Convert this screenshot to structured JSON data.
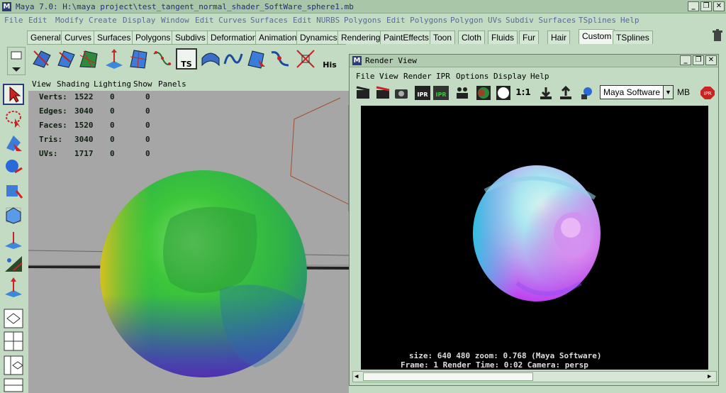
{
  "window": {
    "title": "Maya 7.0: H:\\maya project\\test_tangent_normal_shader_SoftWare_sphere1.mb",
    "minimize_glyph": "_",
    "restore_glyph": "❐",
    "close_glyph": "✕"
  },
  "menubar": [
    "File",
    "Edit",
    "Modify",
    "Create",
    "Display",
    "Window",
    "Edit Curves",
    "Surfaces",
    "Edit NURBS",
    "Polygons",
    "Edit Polygons",
    "Polygon UVs",
    "Subdiv Surfaces",
    "TSplines",
    "Help"
  ],
  "shelf_tabs": [
    "General",
    "Curves",
    "Surfaces",
    "Polygons",
    "Subdivs",
    "Deformation",
    "Animation",
    "Dynamics",
    "Rendering",
    "PaintEffects",
    "Toon",
    "Cloth",
    "Fluids",
    "Fur",
    "Hair",
    "Custom",
    "TSplines"
  ],
  "active_shelf_tab": "Custom",
  "shelf": {
    "ts_label": "TS",
    "his_label": "His"
  },
  "viewport": {
    "menu": [
      "View",
      "Shading",
      "Lighting",
      "Show",
      "Panels"
    ],
    "hud": [
      {
        "label": "Verts:",
        "v1": "1522",
        "v2": "0",
        "v3": "0"
      },
      {
        "label": "Edges:",
        "v1": "3040",
        "v2": "0",
        "v3": "0"
      },
      {
        "label": "Faces:",
        "v1": "1520",
        "v2": "0",
        "v3": "0"
      },
      {
        "label": "Tris:",
        "v1": "3040",
        "v2": "0",
        "v3": "0"
      },
      {
        "label": "UVs:",
        "v1": "1717",
        "v2": "0",
        "v3": "0"
      }
    ]
  },
  "render_view": {
    "title": "Render View",
    "menu": [
      "File",
      "View",
      "Render",
      "IPR",
      "Options",
      "Display",
      "Help"
    ],
    "ratio_label": "1:1",
    "ipr_label": "IPR",
    "renderer": "Maya Software",
    "mb_label": "MB",
    "info_line1": "size:  640  480 zoom: 0.768        (Maya Software)",
    "info_line2": "Frame: 1       Render Time: 0:02       Camera: persp"
  },
  "colors": {
    "ui_bg": "#c3dbc3",
    "title_text": "#1e2e7a",
    "menu_text": "#5a6a96",
    "viewport_bg": "#a6a6a6"
  }
}
